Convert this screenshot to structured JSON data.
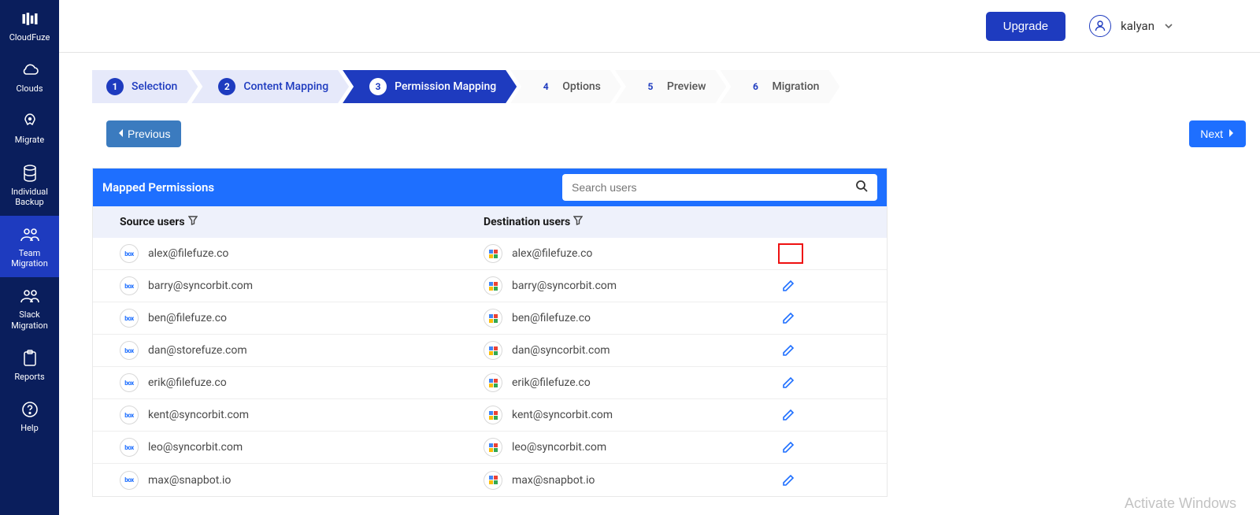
{
  "sidebar": {
    "items": [
      {
        "label": "CloudFuze"
      },
      {
        "label": "Clouds"
      },
      {
        "label": "Migrate"
      },
      {
        "label": "Individual Backup"
      },
      {
        "label": "Team Migration"
      },
      {
        "label": "Slack Migration"
      },
      {
        "label": "Reports"
      },
      {
        "label": "Help"
      }
    ]
  },
  "header": {
    "upgrade": "Upgrade",
    "username": "kalyan"
  },
  "stepper": [
    {
      "num": "1",
      "label": "Selection"
    },
    {
      "num": "2",
      "label": "Content Mapping"
    },
    {
      "num": "3",
      "label": "Permission Mapping"
    },
    {
      "num": "4",
      "label": "Options"
    },
    {
      "num": "5",
      "label": "Preview"
    },
    {
      "num": "6",
      "label": "Migration"
    }
  ],
  "nav": {
    "previous": "Previous",
    "next": "Next"
  },
  "panel": {
    "title": "Mapped Permissions",
    "search_placeholder": "Search users",
    "col_source": "Source users",
    "col_dest": "Destination users"
  },
  "rows": [
    {
      "src": "alex@filefuze.co",
      "dst": "alex@filefuze.co"
    },
    {
      "src": "barry@syncorbit.com",
      "dst": "barry@syncorbit.com"
    },
    {
      "src": "ben@filefuze.co",
      "dst": "ben@filefuze.co"
    },
    {
      "src": "dan@storefuze.com",
      "dst": "dan@syncorbit.com"
    },
    {
      "src": "erik@filefuze.co",
      "dst": "erik@filefuze.co"
    },
    {
      "src": "kent@syncorbit.com",
      "dst": "kent@syncorbit.com"
    },
    {
      "src": "leo@syncorbit.com",
      "dst": "leo@syncorbit.com"
    },
    {
      "src": "max@snapbot.io",
      "dst": "max@snapbot.io"
    }
  ],
  "icons": {
    "box": "box",
    "google": "gd"
  },
  "watermark": "Activate Windows"
}
